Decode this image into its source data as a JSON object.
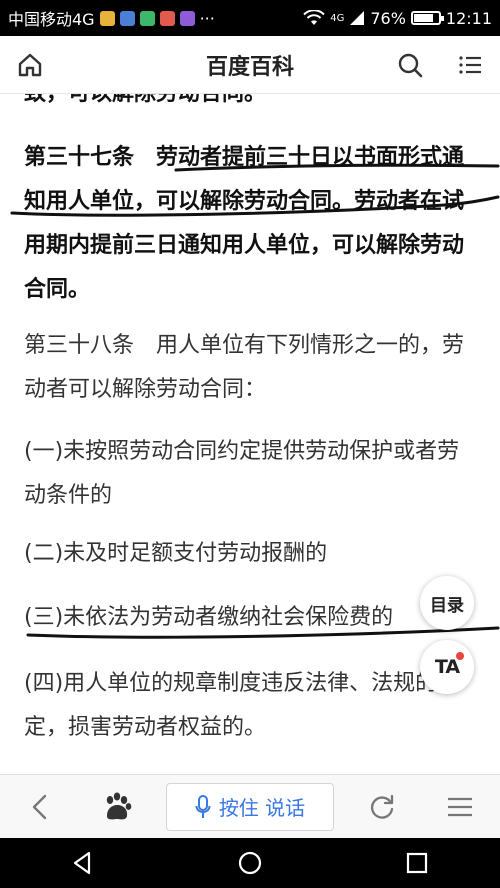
{
  "status_bar": {
    "carrier": "中国移动4G",
    "more": "···",
    "network": "4G",
    "battery": "76%",
    "time": "12:11"
  },
  "header": {
    "title": "百度百科",
    "home_icon": "home-icon",
    "search_icon": "search-icon",
    "menu_icon": "menu-icon"
  },
  "article": {
    "paragraphs": [
      "致，可以解除劳动合同。",
      "第三十七条　劳动者提前三十日以书面形式通知用人单位，可以解除劳动合同。劳动者在试用期内提前三日通知用人单位，可以解除劳动合同。",
      "第三十八条　用人单位有下列情形之一的，劳动者可以解除劳动合同：",
      "(一)未按照劳动合同约定提供劳动保护或者劳动条件的",
      "(二)未及时足额支付劳动报酬的",
      "(三)未依法为劳动者缴纳社会保险费的",
      "(四)用人单位的规章制度违反法律、法规的规定，损害劳动者权益的。"
    ]
  },
  "floating": {
    "toc_label": "目录",
    "ta_label": "TA"
  },
  "toolbar": {
    "voice_label": "按住 说话",
    "back_icon": "back-icon",
    "paw_icon": "baidu-paw-icon",
    "refresh_icon": "refresh-icon",
    "menu_icon": "menu-icon"
  },
  "colors": {
    "accent": "#3778e6",
    "ink": "#111111",
    "notification": "#e8463c"
  }
}
